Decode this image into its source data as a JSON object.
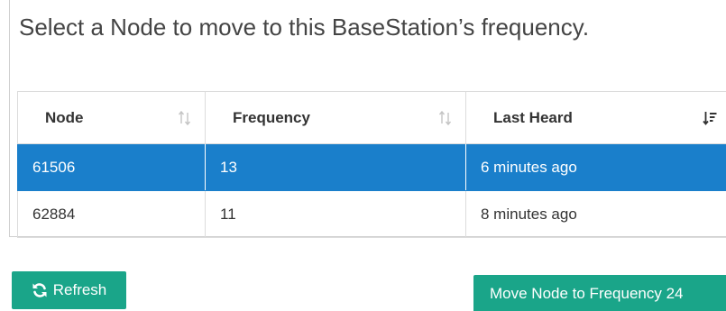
{
  "instruction": "Select a Node to move to this BaseStation’s frequency.",
  "table": {
    "columns": [
      {
        "label": "Node",
        "sort_icon": "sort-icon"
      },
      {
        "label": "Frequency",
        "sort_icon": "sort-icon"
      },
      {
        "label": "Last Heard",
        "sort_icon": "sort-descending-icon"
      }
    ],
    "rows": [
      {
        "node": "61506",
        "frequency": "13",
        "last_heard": "6 minutes ago",
        "selected": true
      },
      {
        "node": "62884",
        "frequency": "11",
        "last_heard": "8 minutes ago",
        "selected": false
      }
    ]
  },
  "buttons": {
    "refresh_label": "Refresh",
    "refresh_icon": "refresh-icon",
    "move_label": "Move Node to Frequency 24"
  },
  "colors": {
    "accent_green": "#1aa589",
    "selected_blue": "#1a7fcb",
    "text": "#333333"
  }
}
